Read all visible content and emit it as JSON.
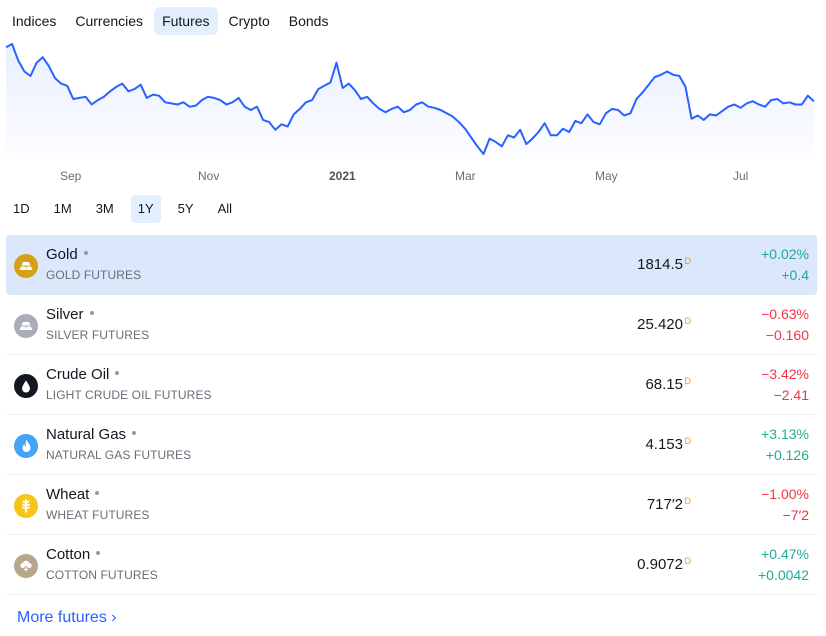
{
  "tabs": [
    {
      "label": "Indices",
      "active": false
    },
    {
      "label": "Currencies",
      "active": false
    },
    {
      "label": "Futures",
      "active": true
    },
    {
      "label": "Crypto",
      "active": false
    },
    {
      "label": "Bonds",
      "active": false
    }
  ],
  "chart": {
    "line_color": "#2962ff",
    "x_labels": [
      "Sep",
      "Nov",
      "2021",
      "Mar",
      "May",
      "Jul"
    ],
    "series_shape": [
      0.92,
      0.95,
      0.8,
      0.7,
      0.66,
      0.78,
      0.83,
      0.75,
      0.64,
      0.59,
      0.57,
      0.45,
      0.46,
      0.47,
      0.4,
      0.44,
      0.47,
      0.52,
      0.56,
      0.59,
      0.52,
      0.54,
      0.58,
      0.46,
      0.49,
      0.48,
      0.42,
      0.41,
      0.4,
      0.42,
      0.38,
      0.39,
      0.44,
      0.47,
      0.46,
      0.44,
      0.4,
      0.42,
      0.46,
      0.38,
      0.35,
      0.38,
      0.26,
      0.24,
      0.17,
      0.22,
      0.2,
      0.31,
      0.36,
      0.42,
      0.44,
      0.54,
      0.57,
      0.6,
      0.78,
      0.55,
      0.59,
      0.53,
      0.45,
      0.47,
      0.41,
      0.36,
      0.33,
      0.36,
      0.38,
      0.33,
      0.35,
      0.4,
      0.42,
      0.38,
      0.37,
      0.35,
      0.32,
      0.29,
      0.24,
      0.18,
      0.1,
      0.02,
      -0.05,
      0.09,
      0.06,
      0.02,
      0.12,
      0.1,
      0.17,
      0.04,
      0.09,
      0.15,
      0.23,
      0.12,
      0.12,
      0.18,
      0.15,
      0.25,
      0.23,
      0.31,
      0.24,
      0.22,
      0.32,
      0.36,
      0.35,
      0.3,
      0.32,
      0.45,
      0.51,
      0.58,
      0.65,
      0.67,
      0.7,
      0.67,
      0.66,
      0.56,
      0.27,
      0.3,
      0.26,
      0.31,
      0.3,
      0.34,
      0.38,
      0.4,
      0.37,
      0.41,
      0.43,
      0.4,
      0.38,
      0.44,
      0.45,
      0.41,
      0.42,
      0.4,
      0.4,
      0.48,
      0.43
    ]
  },
  "ranges": [
    {
      "label": "1D",
      "active": false
    },
    {
      "label": "1M",
      "active": false
    },
    {
      "label": "3M",
      "active": false
    },
    {
      "label": "1Y",
      "active": true
    },
    {
      "label": "5Y",
      "active": false
    },
    {
      "label": "All",
      "active": false
    }
  ],
  "futures": [
    {
      "name": "Gold",
      "subtitle": "GOLD FUTURES",
      "price": "1814.5",
      "delay": "D",
      "pct": "+0.02%",
      "change": "+0.4",
      "direction": "pos",
      "icon": "gold-bar-icon",
      "icon_color": "#d4a017",
      "active": true
    },
    {
      "name": "Silver",
      "subtitle": "SILVER FUTURES",
      "price": "25.420",
      "delay": "D",
      "pct": "−0.63%",
      "change": "−0.160",
      "direction": "neg",
      "icon": "silver-bar-icon",
      "icon_color": "#a9adb8",
      "active": false
    },
    {
      "name": "Crude Oil",
      "subtitle": "LIGHT CRUDE OIL FUTURES",
      "price": "68.15",
      "delay": "D",
      "pct": "−3.42%",
      "change": "−2.41",
      "direction": "neg",
      "icon": "oil-drop-icon",
      "icon_color": "#131722",
      "active": false
    },
    {
      "name": "Natural Gas",
      "subtitle": "NATURAL GAS FUTURES",
      "price": "4.153",
      "delay": "D",
      "pct": "+3.13%",
      "change": "+0.126",
      "direction": "pos",
      "icon": "flame-icon",
      "icon_color": "#42a5f5",
      "active": false
    },
    {
      "name": "Wheat",
      "subtitle": "WHEAT FUTURES",
      "price": "717′2",
      "delay": "D",
      "pct": "−1.00%",
      "change": "−7′2",
      "direction": "neg",
      "icon": "wheat-icon",
      "icon_color": "#f5c518",
      "active": false
    },
    {
      "name": "Cotton",
      "subtitle": "COTTON FUTURES",
      "price": "0.9072",
      "delay": "D",
      "pct": "+0.47%",
      "change": "+0.0042",
      "direction": "pos",
      "icon": "cotton-icon",
      "icon_color": "#b8a78a",
      "active": false
    }
  ],
  "more_link": "More futures ›"
}
